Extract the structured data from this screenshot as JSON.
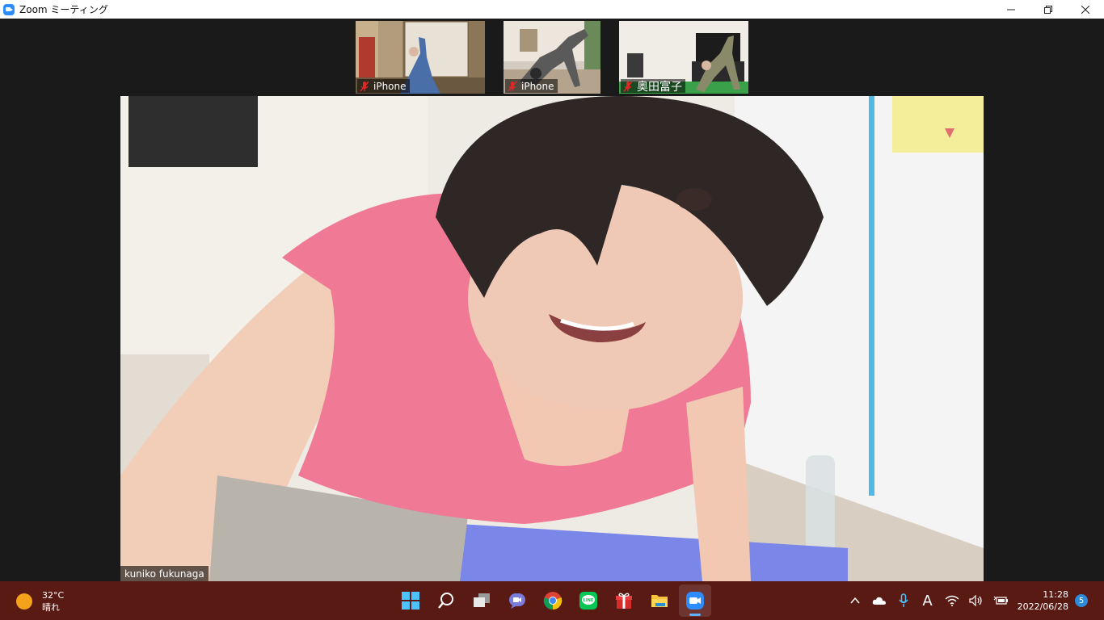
{
  "window": {
    "title": "Zoom ミーティング",
    "controls": [
      "minimize",
      "restore",
      "close"
    ]
  },
  "thumbnails": [
    {
      "name": "iPhone",
      "muted": true
    },
    {
      "name": "iPhone",
      "muted": true
    },
    {
      "name": "奥田富子",
      "muted": true
    }
  ],
  "main_video": {
    "speaker_name": "kuniko fukunaga"
  },
  "taskbar": {
    "weather": {
      "temp": "32°C",
      "condition": "晴れ"
    },
    "apps": [
      "start-icon",
      "search-icon",
      "task-view-icon",
      "chat-icon",
      "chrome-icon",
      "line-icon",
      "gift-icon",
      "file-explorer-icon",
      "zoom-icon"
    ],
    "clock": {
      "time": "11:28",
      "date": "2022/06/28"
    },
    "notifications": "5",
    "ime": "A"
  },
  "colors": {
    "accent": "#2d8cff",
    "taskbar": "#5a1a14",
    "mute_red": "#e02828"
  }
}
